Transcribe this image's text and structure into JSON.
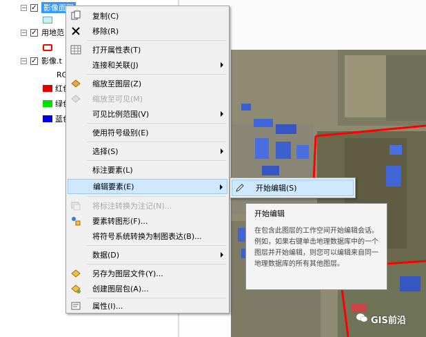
{
  "toc": {
    "layers": [
      {
        "label": "影像面积",
        "selected": true,
        "checked": true
      },
      {
        "label": "用地范",
        "checked": true
      },
      {
        "label": "影像.t",
        "checked": true
      }
    ],
    "raster_band_header": "RG",
    "bands": [
      {
        "label": "红色",
        "color": "#e00000"
      },
      {
        "label": "绿色",
        "color": "#00dd00"
      },
      {
        "label": "蓝色",
        "color": "#0000e0"
      }
    ]
  },
  "menu": {
    "items": [
      {
        "label": "复制(C)",
        "icon": "copy-icon"
      },
      {
        "label": "移除(R)",
        "icon": "remove-icon"
      },
      {
        "label": "打开属性表(T)",
        "icon": "table-icon"
      },
      {
        "label": "连接和关联(J)",
        "submenu": true
      },
      {
        "label": "缩放至图层(Z)",
        "icon": "zoom-to-layer-icon"
      },
      {
        "label": "缩放至可见(M)",
        "icon": "zoom-visible-icon",
        "disabled": true
      },
      {
        "label": "可见比例范围(V)",
        "submenu": true
      },
      {
        "label": "使用符号级别(E)"
      },
      {
        "label": "选择(S)",
        "submenu": true
      },
      {
        "label": "标注要素(L)"
      },
      {
        "label": "编辑要素(E)",
        "submenu": true,
        "highlighted": true
      },
      {
        "label": "将标注转换为注记(N)...",
        "icon": "convert-labels-icon",
        "disabled": true
      },
      {
        "label": "要素转图形(F)...",
        "icon": "features-to-graphics-icon"
      },
      {
        "label": "将符号系统转换为制图表达(B)..."
      },
      {
        "label": "数据(D)",
        "submenu": true
      },
      {
        "label": "另存为图层文件(Y)...",
        "icon": "save-layer-icon"
      },
      {
        "label": "创建图层包(A)...",
        "icon": "layer-package-icon"
      },
      {
        "label": "属性(I)...",
        "icon": "properties-icon"
      }
    ]
  },
  "submenu": {
    "start_editing": "开始编辑(S)"
  },
  "tooltip": {
    "title": "开始编辑",
    "body": "在包含此图层的工作空间开始编辑会话。例如，如果右键单击地理数据库中的一个图层并开始编辑，则您可以编辑来自同一地理数据库的所有其他图层。"
  },
  "watermark": "GIS前沿",
  "colors": {
    "selection": "#3399ff",
    "menu_highlight": "#cde8ff",
    "boundary": "#ff0000"
  }
}
